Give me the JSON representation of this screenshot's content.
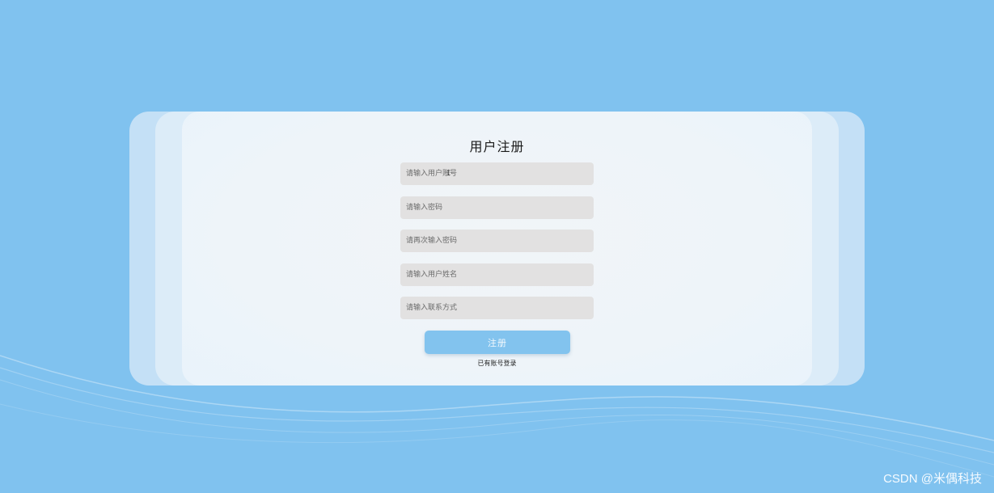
{
  "form": {
    "title": "用户注册",
    "fields": [
      {
        "placeholder": "请输入用户账号",
        "value": ""
      },
      {
        "placeholder": "请输入密码",
        "value": ""
      },
      {
        "placeholder": "请再次输入密码",
        "value": ""
      },
      {
        "placeholder": "请输入用户姓名",
        "value": ""
      },
      {
        "placeholder": "请输入联系方式",
        "value": ""
      }
    ],
    "submit_label": "注册",
    "login_link": "已有账号登录"
  },
  "watermark": "CSDN @米偶科技",
  "colors": {
    "page_background": "#80c2ef",
    "card_background": "#eef4f9",
    "input_background": "#e2e1e1",
    "button_background": "#82c3ee"
  }
}
